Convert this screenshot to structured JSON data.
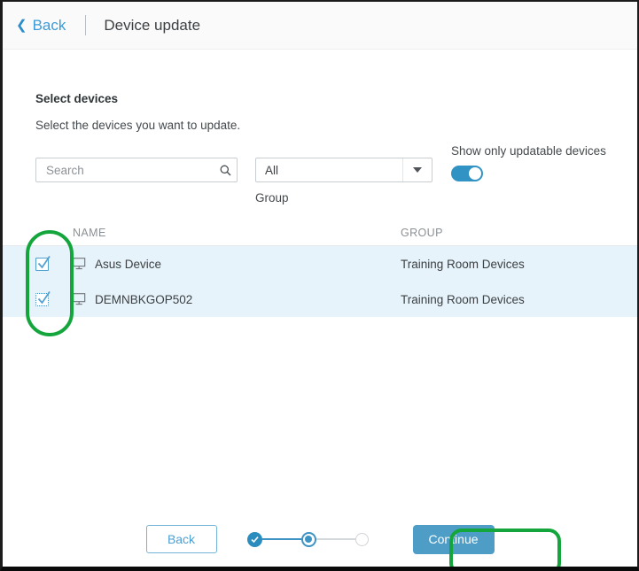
{
  "header": {
    "back_label": "Back",
    "back_chevron": "chevron-left-icon",
    "title": "Device update"
  },
  "main": {
    "section_title": "Select devices",
    "section_subtitle": "Select the devices you want to update."
  },
  "filters": {
    "search": {
      "placeholder": "Search",
      "value": "",
      "icon": "search-icon"
    },
    "group": {
      "label": "Group",
      "selected": "All",
      "options": [
        "All"
      ],
      "icon": "chevron-down-icon"
    },
    "updatable_toggle": {
      "label": "Show only updatable devices",
      "state": "on"
    }
  },
  "table": {
    "columns": [
      "NAME",
      "GROUP"
    ],
    "rows": [
      {
        "checked": true,
        "focused": false,
        "icon": "monitor-icon",
        "name": "Asus Device",
        "group": "Training Room Devices"
      },
      {
        "checked": true,
        "focused": true,
        "icon": "monitor-icon",
        "name": "DEMNBKGOP502",
        "group": "Training Room Devices"
      }
    ]
  },
  "footer": {
    "back_label": "Back",
    "continue_label": "Continue",
    "steps": [
      {
        "state": "done"
      },
      {
        "state": "current"
      },
      {
        "state": "todo"
      }
    ]
  },
  "colors": {
    "accent_blue": "#3a9bd9",
    "button_blue": "#4d9dc6",
    "row_selected": "#e6f3fb",
    "annotation_green": "#14a53c",
    "toggle_on": "#3093c4"
  }
}
